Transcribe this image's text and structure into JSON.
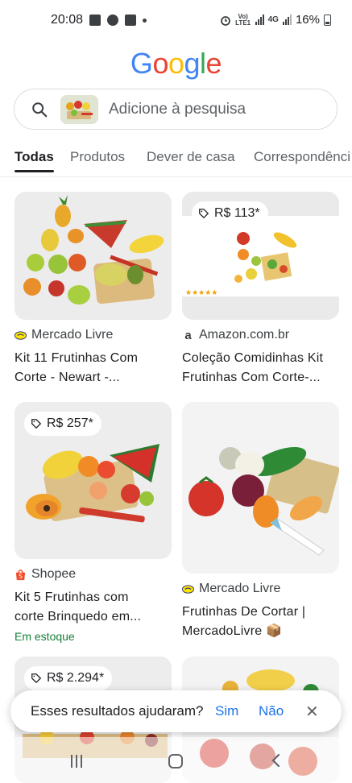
{
  "status": {
    "time": "20:08",
    "net_label": "Vo) LTE1",
    "net4g": "4G",
    "battery": "16%"
  },
  "logo": {
    "text": "Google",
    "letters": [
      {
        "ch": "G",
        "color": "#4285F4"
      },
      {
        "ch": "o",
        "color": "#EA4335"
      },
      {
        "ch": "o",
        "color": "#FBBC05"
      },
      {
        "ch": "g",
        "color": "#4285F4"
      },
      {
        "ch": "l",
        "color": "#34A853"
      },
      {
        "ch": "e",
        "color": "#EA4335"
      }
    ]
  },
  "search": {
    "placeholder": "Adicione à pesquisa",
    "icon": "search-icon"
  },
  "tabs": [
    {
      "label": "Todas",
      "active": true
    },
    {
      "label": "Produtos",
      "active": false
    },
    {
      "label": "Dever de casa",
      "active": false
    },
    {
      "label": "Correspondênci",
      "active": false
    }
  ],
  "results": [
    {
      "price": "",
      "source": "Mercado Livre",
      "source_icon": "mercadolivre-icon",
      "title_line1": "Kit 11 Frutinhas Com",
      "title_line2": "Corte - Newart -...",
      "stock": ""
    },
    {
      "price": "R$ 113*",
      "source": "Amazon.com.br",
      "source_icon": "amazon-icon",
      "title_line1": "Coleção Comidinhas Kit",
      "title_line2": "Frutinhas Com Corte-...",
      "stock": ""
    },
    {
      "price": "R$ 257*",
      "source": "Shopee",
      "source_icon": "shopee-icon",
      "title_line1": "Kit 5 Frutinhas com",
      "title_line2": "corte Brinquedo em...",
      "stock": "Em estoque"
    },
    {
      "price": "",
      "source": "Mercado Livre",
      "source_icon": "mercadolivre-icon",
      "title_line1": "Frutinhas De Cortar |",
      "title_line2": "MercadoLivre 📦",
      "stock": ""
    },
    {
      "price": "R$ 2.294*",
      "source": "",
      "source_icon": "",
      "title_line1": "",
      "title_line2": "",
      "stock": ""
    }
  ],
  "feedback": {
    "question": "Esses resultados ajudaram?",
    "yes": "Sim",
    "no": "Não",
    "close": "✕"
  },
  "colors": {
    "link": "#1a73e8",
    "stock": "#188038",
    "text": "#202124",
    "muted": "#5f6368"
  }
}
